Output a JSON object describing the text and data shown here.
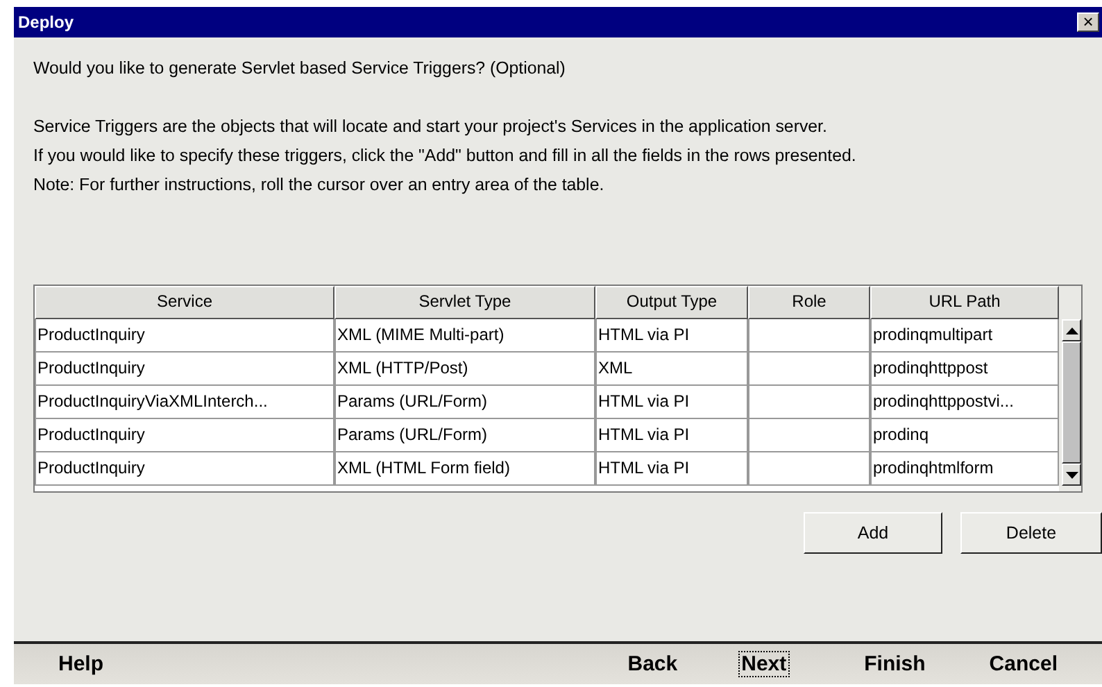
{
  "window": {
    "title": "Deploy",
    "close": "×"
  },
  "question": "Would you like to generate Servlet based Service Triggers? (Optional)",
  "description": [
    "Service Triggers are the objects that will locate and start your project's Services in the application server.",
    "If you would like to specify these triggers, click the \"Add\" button and fill in all the fields in the rows presented.",
    "Note:  For further instructions, roll the cursor over an entry area of the table."
  ],
  "table": {
    "columns": [
      "Service",
      "Servlet Type",
      "Output Type",
      "Role",
      "URL Path"
    ],
    "rows": [
      [
        "ProductInquiry",
        "XML (MIME Multi-part)",
        "HTML via PI",
        "",
        "prodinqmultipart"
      ],
      [
        "ProductInquiry",
        "XML (HTTP/Post)",
        "XML",
        "",
        "prodinqhttppost"
      ],
      [
        "ProductInquiryViaXMLInterch...",
        "Params (URL/Form)",
        "HTML via PI",
        "",
        "prodinqhttppostvi..."
      ],
      [
        "ProductInquiry",
        "Params (URL/Form)",
        "HTML via PI",
        "",
        "prodinq"
      ],
      [
        "ProductInquiry",
        "XML (HTML Form field)",
        "HTML via PI",
        "",
        "prodinqhtmlform"
      ]
    ]
  },
  "table_buttons": [
    "Add",
    "Delete"
  ],
  "footer_buttons": [
    {
      "label": "Help",
      "focused": false
    },
    {
      "label": "Back",
      "focused": false
    },
    {
      "label": "Next",
      "focused": true
    },
    {
      "label": "Finish",
      "focused": false
    },
    {
      "label": "Cancel",
      "focused": false
    }
  ]
}
